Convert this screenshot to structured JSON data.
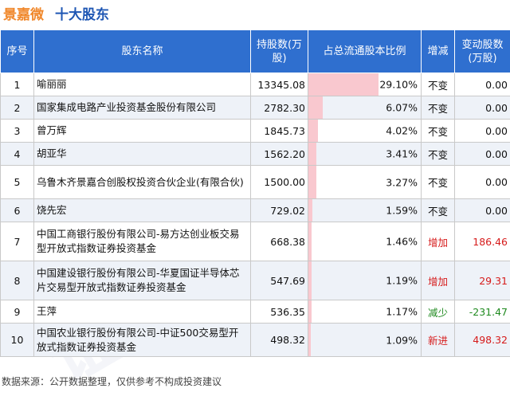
{
  "title": {
    "company": "景嘉微",
    "subject": "十大股东"
  },
  "headers": {
    "rank": "序号",
    "name": "股东名称",
    "shares": "持股数(万股)",
    "ratio": "占总流通股本比例",
    "change": "增减",
    "change_shares": "变动股数(万股)"
  },
  "rows": [
    {
      "rank": "1",
      "name": "喻丽丽",
      "shares": "13345.08",
      "ratio": "29.10%",
      "ratio_value": 29.1,
      "change": "不变",
      "change_kind": "none",
      "change_shares": "0.00"
    },
    {
      "rank": "2",
      "name": "国家集成电路产业投资基金股份有限公司",
      "shares": "2782.30",
      "ratio": "6.07%",
      "ratio_value": 6.07,
      "change": "不变",
      "change_kind": "none",
      "change_shares": "0.00"
    },
    {
      "rank": "3",
      "name": "曾万辉",
      "shares": "1845.73",
      "ratio": "4.02%",
      "ratio_value": 4.02,
      "change": "不变",
      "change_kind": "none",
      "change_shares": "0.00"
    },
    {
      "rank": "4",
      "name": "胡亚华",
      "shares": "1562.20",
      "ratio": "3.41%",
      "ratio_value": 3.41,
      "change": "不变",
      "change_kind": "none",
      "change_shares": "0.00"
    },
    {
      "rank": "5",
      "name": "乌鲁木齐景嘉合创股权投资合伙企业(有限合伙)",
      "shares": "1500.00",
      "ratio": "3.27%",
      "ratio_value": 3.27,
      "change": "不变",
      "change_kind": "none",
      "change_shares": "0.00"
    },
    {
      "rank": "6",
      "name": "饶先宏",
      "shares": "729.02",
      "ratio": "1.59%",
      "ratio_value": 1.59,
      "change": "不变",
      "change_kind": "none",
      "change_shares": "0.00"
    },
    {
      "rank": "7",
      "name": "中国工商银行股份有限公司-易方达创业板交易型开放式指数证券投资基金",
      "shares": "668.38",
      "ratio": "1.46%",
      "ratio_value": 1.46,
      "change": "增加",
      "change_kind": "up",
      "change_shares": "186.46"
    },
    {
      "rank": "8",
      "name": "中国建设银行股份有限公司-华夏国证半导体芯片交易型开放式指数证券投资基金",
      "shares": "547.69",
      "ratio": "1.19%",
      "ratio_value": 1.19,
      "change": "增加",
      "change_kind": "up",
      "change_shares": "29.31"
    },
    {
      "rank": "9",
      "name": "王萍",
      "shares": "536.35",
      "ratio": "1.17%",
      "ratio_value": 1.17,
      "change": "减少",
      "change_kind": "down",
      "change_shares": "-231.47"
    },
    {
      "rank": "10",
      "name": "中国农业银行股份有限公司-中证500交易型开放式指数证券投资基金",
      "shares": "498.32",
      "ratio": "1.09%",
      "ratio_value": 1.09,
      "change": "新进",
      "change_kind": "new",
      "change_shares": "498.32"
    }
  ],
  "footer": "数据来源：公开数据整理，仅供参考不构成投资建议",
  "colors": {
    "header_bg": "#2f6fcf",
    "bar": "#f9c8cf",
    "up": "#d61b1b",
    "down": "#1f8a1f",
    "company": "#f0872a",
    "title": "#1f57b4"
  }
}
